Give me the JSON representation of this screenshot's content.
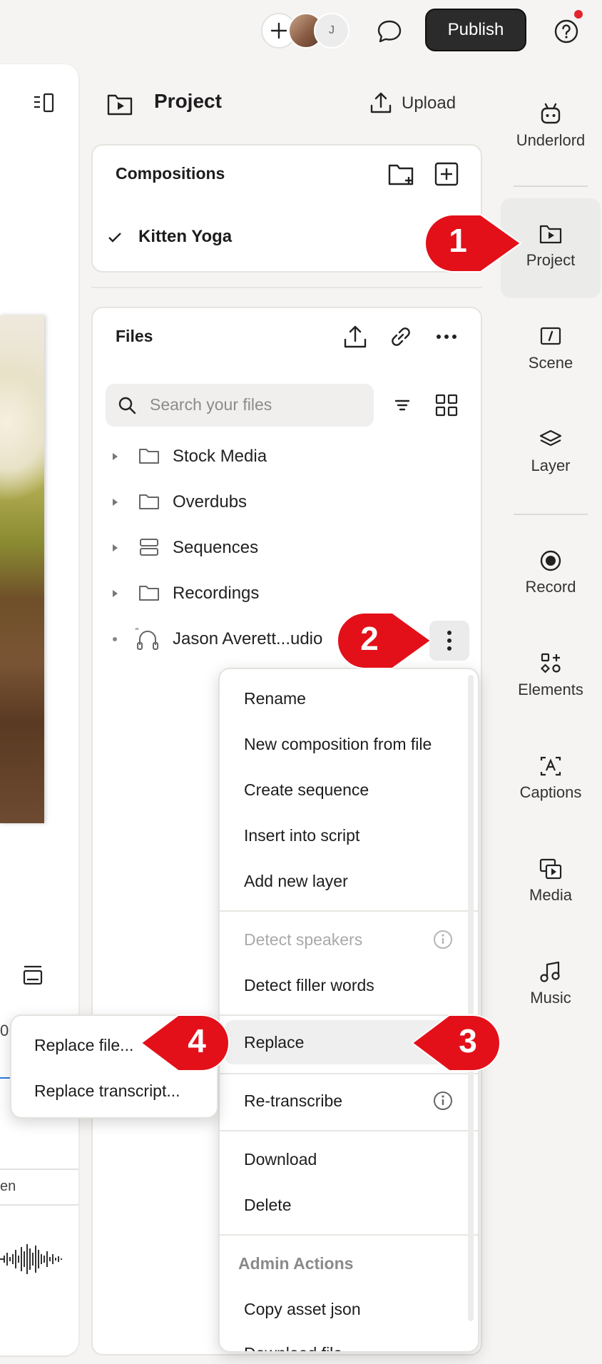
{
  "topbar": {
    "avatar_initial": "J",
    "publish_label": "Publish"
  },
  "project": {
    "title": "Project",
    "upload_label": "Upload"
  },
  "compositions": {
    "title": "Compositions",
    "items": [
      "Kitten Yoga"
    ]
  },
  "files": {
    "title": "Files",
    "search_placeholder": "Search your files",
    "items": [
      {
        "label": "Stock Media",
        "icon": "folder-icon"
      },
      {
        "label": "Overdubs",
        "icon": "folder-icon"
      },
      {
        "label": "Sequences",
        "icon": "sequence-icon"
      },
      {
        "label": "Recordings",
        "icon": "folder-icon"
      },
      {
        "label": "Jason Averett...udio",
        "icon": "audio-file-icon"
      }
    ]
  },
  "context_menu": {
    "rename": "Rename",
    "new_composition": "New composition from file",
    "create_sequence": "Create sequence",
    "insert_into_script": "Insert into script",
    "add_new_layer": "Add new layer",
    "detect_speakers": "Detect speakers",
    "detect_filler": "Detect filler words",
    "replace": "Replace",
    "retranscribe": "Re-transcribe",
    "download": "Download",
    "delete": "Delete",
    "admin_header": "Admin Actions",
    "copy_asset_json": "Copy asset json",
    "download_file": "Download file"
  },
  "submenu": {
    "replace_file": "Replace file...",
    "replace_transcript": "Replace transcript..."
  },
  "rail": {
    "underlord": "Underlord",
    "project": "Project",
    "scene": "Scene",
    "layer": "Layer",
    "record": "Record",
    "elements": "Elements",
    "captions": "Captions",
    "media": "Media",
    "music": "Music"
  },
  "left_pane": {
    "track_label_fragment": "en",
    "timeline_char": "0"
  },
  "callouts": [
    "1",
    "2",
    "3",
    "4"
  ],
  "colors": {
    "callout_red": "#e3101a",
    "publish_bg": "#2b2b2b",
    "notification_dot": "#e3262e"
  }
}
